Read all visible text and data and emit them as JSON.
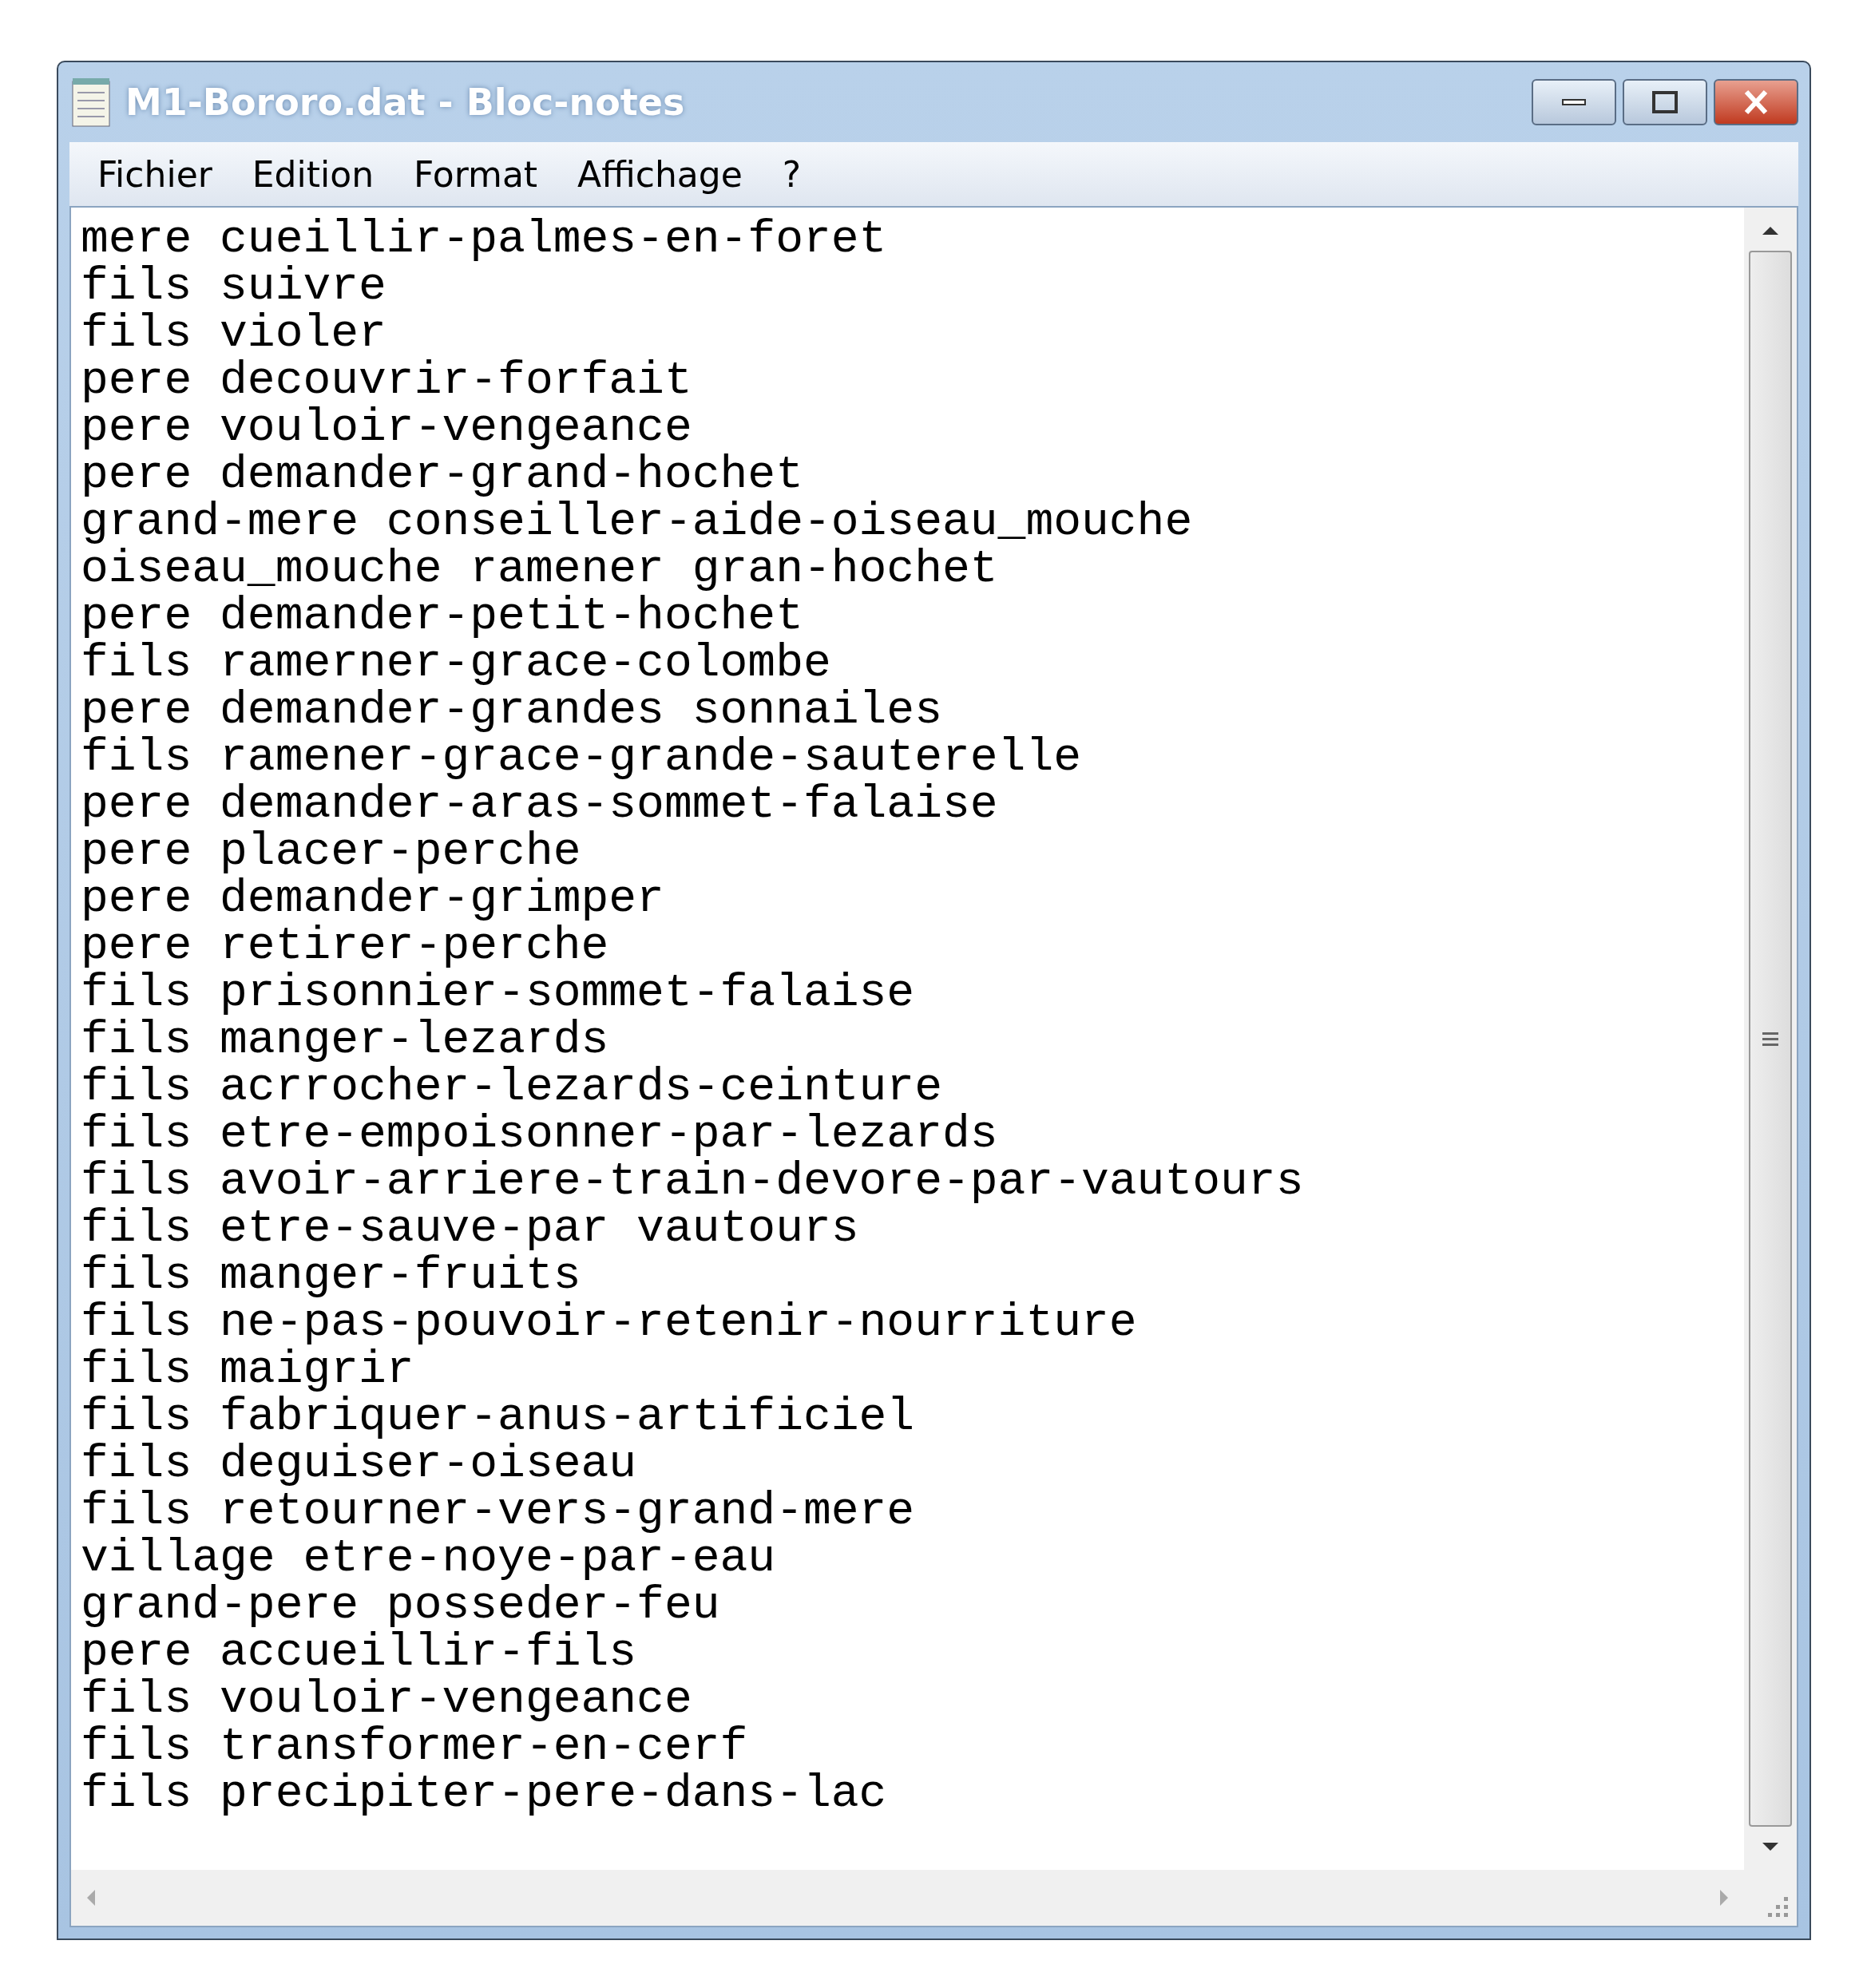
{
  "window": {
    "title": "M1-Bororo.dat - Bloc-notes"
  },
  "menu": [
    {
      "label": "Fichier"
    },
    {
      "label": "Edition"
    },
    {
      "label": "Format"
    },
    {
      "label": "Affichage"
    },
    {
      "label": "?"
    }
  ],
  "lines": [
    "mere cueillir-palmes-en-foret",
    "fils suivre",
    "fils violer",
    "pere decouvrir-forfait",
    "pere vouloir-vengeance",
    "pere demander-grand-hochet",
    "grand-mere conseiller-aide-oiseau_mouche",
    "oiseau_mouche ramener gran-hochet",
    "pere demander-petit-hochet",
    "fils ramerner-grace-colombe",
    "pere demander-grandes sonnailes",
    "fils ramener-grace-grande-sauterelle",
    "pere demander-aras-sommet-falaise",
    "pere placer-perche",
    "pere demander-grimper",
    "pere retirer-perche",
    "fils prisonnier-sommet-falaise",
    "fils manger-lezards",
    "fils acrrocher-lezards-ceinture",
    "fils etre-empoisonner-par-lezards",
    "fils avoir-arriere-train-devore-par-vautours",
    "fils etre-sauve-par vautours",
    "fils manger-fruits",
    "fils ne-pas-pouvoir-retenir-nourriture",
    "fils maigrir",
    "fils fabriquer-anus-artificiel",
    "fils deguiser-oiseau",
    "fils retourner-vers-grand-mere",
    "village etre-noye-par-eau",
    "grand-pere posseder-feu",
    "pere accueillir-fils",
    "fils vouloir-vengeance",
    "fils transformer-en-cerf",
    "fils precipiter-pere-dans-lac"
  ]
}
